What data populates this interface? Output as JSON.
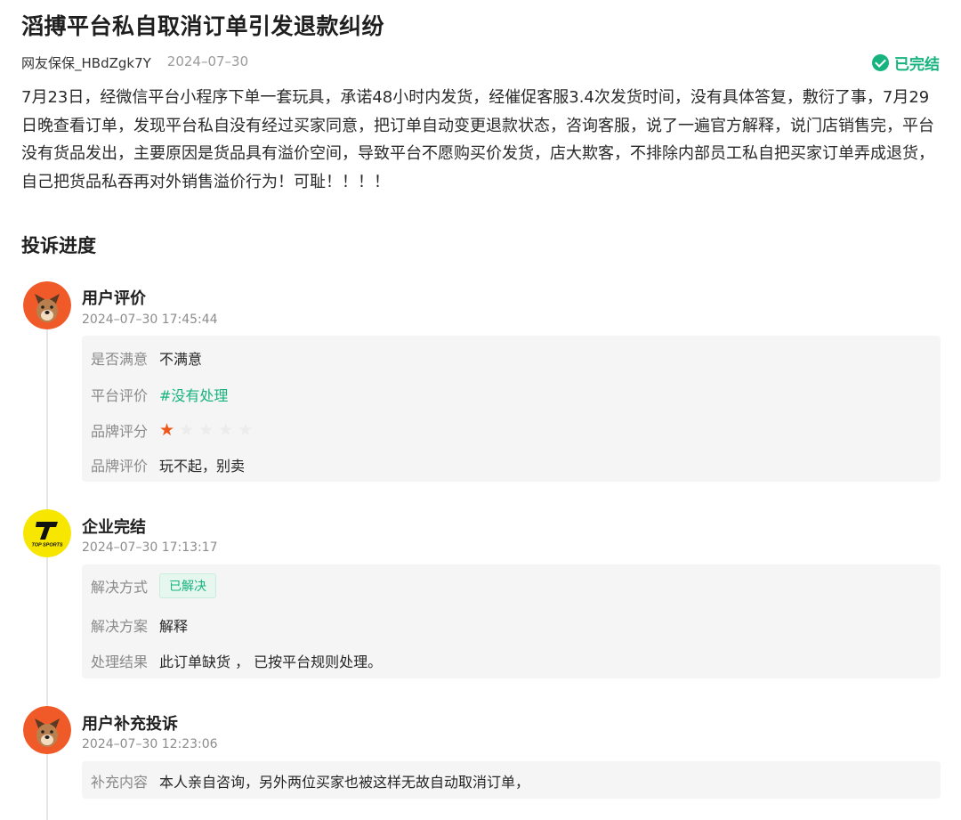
{
  "title": "滔搏平台私自取消订单引发退款纠纷",
  "meta": {
    "user": "网友保保_HBdZgk7Y",
    "date": "2024–07–30"
  },
  "status": {
    "label": "已完结",
    "color": "#16b37f",
    "icon": "check-circle-icon"
  },
  "body_text": "7月23日，经微信平台小程序下单一套玩具，承诺48小时内发货，经催促客服3.4次发货时间，没有具体答复，敷衍了事，7月29日晚查看订单，发现平台私自没有经过买家同意，把订单自动变更退款状态，咨询客服，说了一遍官方解释，说门店销售完，平台没有货品发出，主要原因是货品具有溢价空间，导致平台不愿购买价发货，店大欺客，不排除内部员工私自把买家订单弄成退货，自己把货品私吞再对外销售溢价行为！可耻！！！！",
  "progress_title": "投诉进度",
  "events": [
    {
      "title": "用户评价",
      "time": "2024–07–30 17:45:44",
      "avatar": "dog-avatar-icon",
      "rows": {
        "satisfied_label": "是否满意",
        "satisfied_value": "不满意",
        "platform_label": "平台评价",
        "platform_value": "#没有处理",
        "brand_score_label": "品牌评分",
        "brand_score": 1,
        "brand_score_max": 5,
        "brand_review_label": "品牌评价",
        "brand_review_value": "玩不起，别卖"
      }
    },
    {
      "title": "企业完结",
      "time": "2024–07–30 17:13:17",
      "avatar": "topsports-logo-icon",
      "logo_text": "TOP SPORTS",
      "rows": {
        "method_label": "解决方式",
        "method_value": "已解决",
        "plan_label": "解决方案",
        "plan_value": "解释",
        "result_label": "处理结果",
        "result_value": "此订单缺货 ， 已按平台规则处理。"
      }
    },
    {
      "title": "用户补充投诉",
      "time": "2024–07–30 12:23:06",
      "avatar": "dog-avatar-icon",
      "rows": {
        "extra_label": "补充内容",
        "extra_value": "本人亲自咨询，另外两位买家也被这样无故自动取消订单，"
      }
    }
  ],
  "colors": {
    "accent": "#16b37f",
    "star_on": "#f0571a",
    "avatar_bg": "#f05a28",
    "logo_bg": "#f7e600"
  }
}
